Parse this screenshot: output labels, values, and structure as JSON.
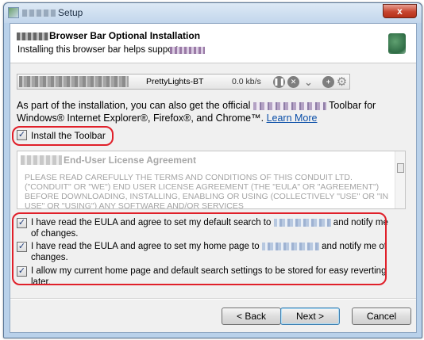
{
  "window": {
    "title": "Setup",
    "close_symbol": "x"
  },
  "header": {
    "title": "Browser Bar Optional Installation",
    "subtitle": "Installing this browser bar helps support"
  },
  "download": {
    "name": "PrettyLights-BT",
    "speed": "0.0 kb/s",
    "icons": [
      "pause-icon",
      "stop-icon",
      "chevron-down-icon",
      "add-icon",
      "gear-icon"
    ]
  },
  "intro": {
    "line_start": "As part of the installation, you can also get the official",
    "line_end": "Toolbar for Windows® Internet Explorer®, Firefox®, and Chrome™.",
    "link": "Learn More"
  },
  "install_toolbar": {
    "label": "Install the Toolbar",
    "checked": true
  },
  "eula": {
    "title": "End-User License Agreement",
    "text": "PLEASE READ CAREFULLY THE TERMS AND CONDITIONS OF THIS CONDUIT LTD. (\"CONDUIT\" OR \"WE\") END USER LICENSE AGREEMENT (THE \"EULA\" OR \"AGREEMENT\") BEFORE DOWNLOADING, INSTALLING, ENABLING OR USING (COLLECTIVELY \"USE\" OR \"IN USE\" OR \"USING\") ANY SOFTWARE AND/OR SERVICES"
  },
  "agreements": [
    {
      "before": "I have read the EULA and agree to set my default search to",
      "after": "and notify me of changes.",
      "checked": true
    },
    {
      "before": "I have read the EULA and agree to set my home page to",
      "after": "and notify me of changes.",
      "checked": true
    },
    {
      "before": "I allow my current home page and default search settings to be stored for easy reverting later.",
      "after": "",
      "checked": true
    }
  ],
  "buttons": {
    "back": "< Back",
    "next": "Next >",
    "cancel": "Cancel"
  },
  "colors": {
    "highlight_oval": "#e0202a",
    "link": "#0b4fa8",
    "close_button": "#c7452f"
  }
}
